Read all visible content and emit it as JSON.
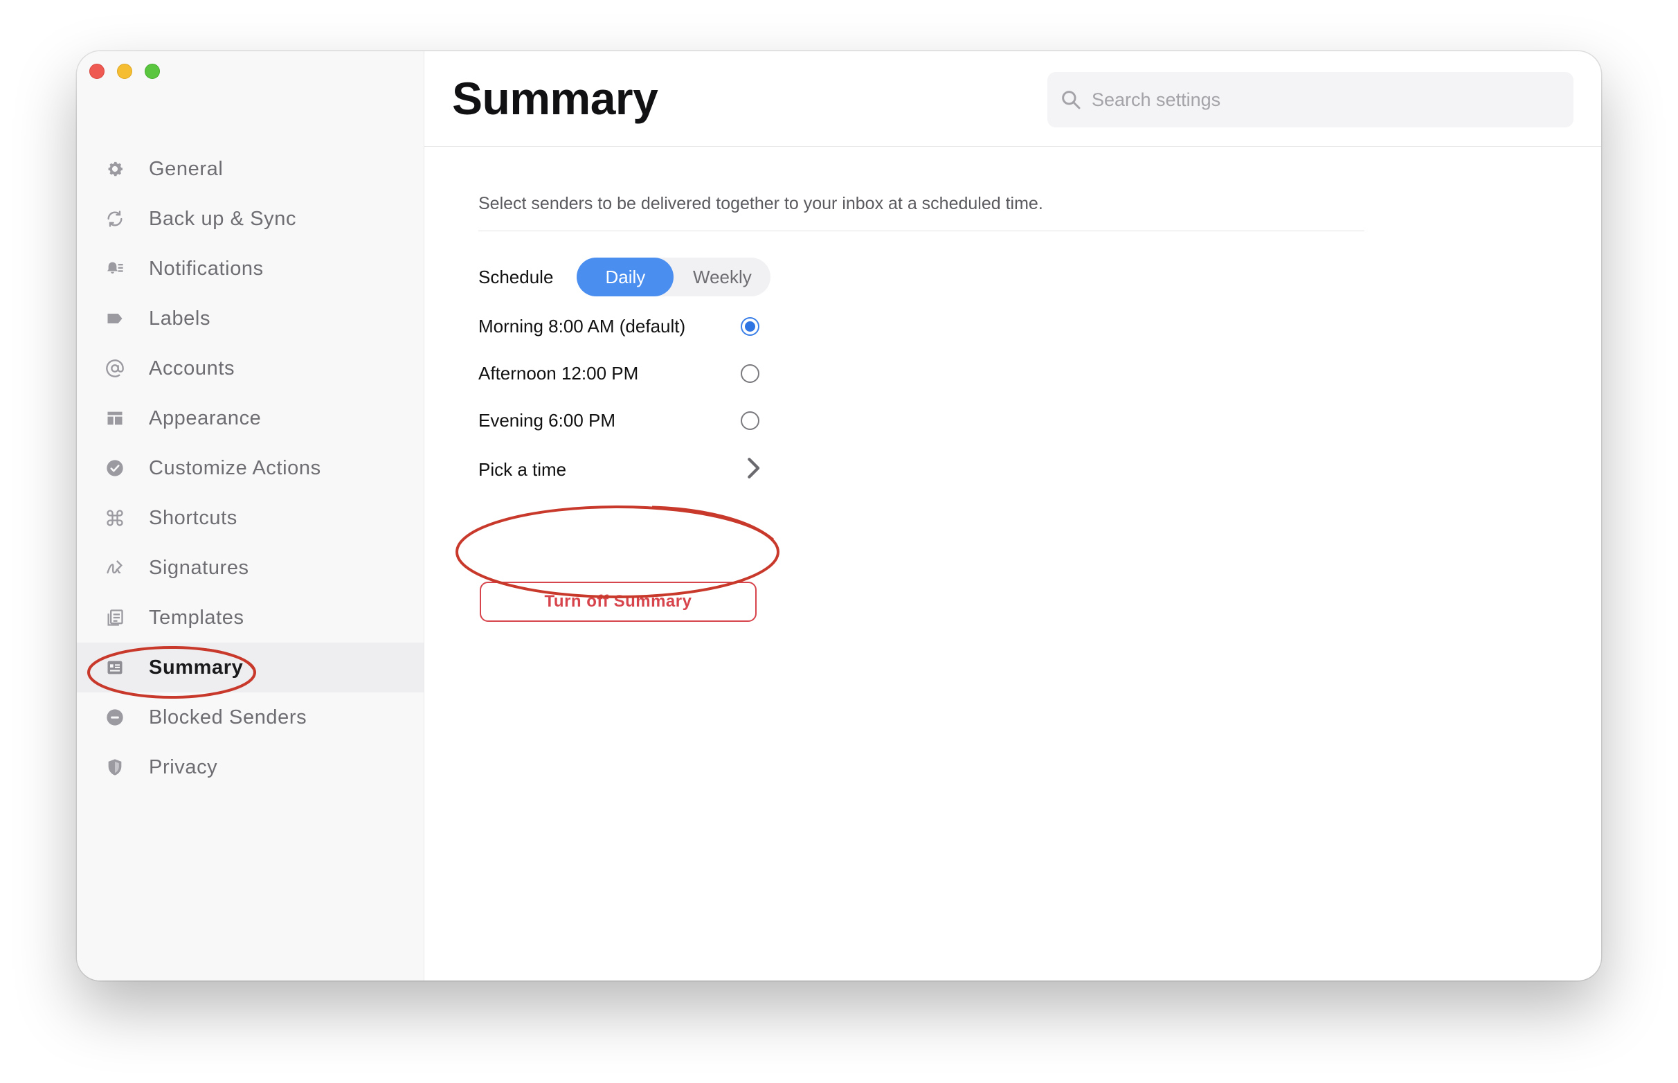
{
  "window": {
    "controls": [
      "close",
      "minimize",
      "zoom"
    ]
  },
  "sidebar": {
    "items": [
      {
        "label": "General",
        "icon": "gear-icon"
      },
      {
        "label": "Back up & Sync",
        "icon": "sync-icon"
      },
      {
        "label": "Notifications",
        "icon": "bell-icon"
      },
      {
        "label": "Labels",
        "icon": "label-tag-icon"
      },
      {
        "label": "Accounts",
        "icon": "at-sign-icon"
      },
      {
        "label": "Appearance",
        "icon": "layout-icon"
      },
      {
        "label": "Customize Actions",
        "icon": "check-circle-icon"
      },
      {
        "label": "Shortcuts",
        "icon": "command-key-icon"
      },
      {
        "label": "Signatures",
        "icon": "signature-pen-icon"
      },
      {
        "label": "Templates",
        "icon": "templates-icon"
      },
      {
        "label": "Summary",
        "icon": "summary-icon",
        "active": true
      },
      {
        "label": "Blocked Senders",
        "icon": "blocked-icon"
      },
      {
        "label": "Privacy",
        "icon": "shield-icon"
      }
    ]
  },
  "header": {
    "title": "Summary",
    "search_placeholder": "Search settings"
  },
  "main": {
    "description": "Select senders to be delivered together to your inbox at a scheduled time.",
    "schedule": {
      "label": "Schedule",
      "options": [
        "Daily",
        "Weekly"
      ],
      "selected": "Daily"
    },
    "times": [
      {
        "label": "Morning 8:00 AM (default)",
        "checked": true
      },
      {
        "label": "Afternoon 12:00 PM",
        "checked": false
      },
      {
        "label": "Evening 6:00 PM",
        "checked": false
      }
    ],
    "pick_time_label": "Pick a time",
    "turn_off_label": "Turn off Summary"
  },
  "colors": {
    "accent": "#4a8ef0",
    "danger": "#d7444c",
    "annotation": "#c8392b"
  }
}
